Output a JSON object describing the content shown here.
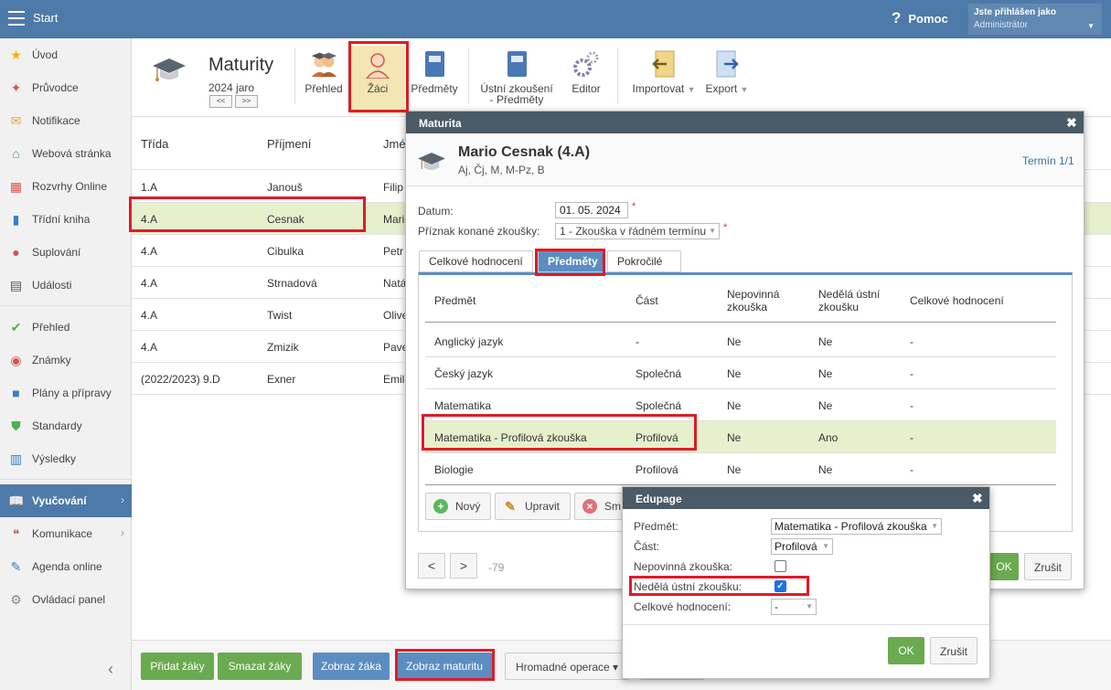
{
  "topbar": {
    "start": "Start",
    "help": "Pomoc",
    "user_line1": "Jste přihlášen jako",
    "user_line2": "Administrátor"
  },
  "sidebar": {
    "items": [
      {
        "label": "Úvod",
        "icon": "star-icon",
        "color": "#f2b200"
      },
      {
        "label": "Průvodce",
        "icon": "magic-wand-icon",
        "color": "#d9534f"
      },
      {
        "label": "Notifikace",
        "icon": "envelope-icon",
        "color": "#f0a030"
      },
      {
        "label": "Webová stránka",
        "icon": "home-icon",
        "color": "#3fa35c"
      },
      {
        "label": "Rozvrhy Online",
        "icon": "timetable-icon",
        "color": "#d9534f"
      },
      {
        "label": "Třídní kniha",
        "icon": "book-icon",
        "color": "#3a7ec4"
      },
      {
        "label": "Suplování",
        "icon": "person-icon",
        "color": "#d9534f"
      },
      {
        "label": "Události",
        "icon": "calendar-icon",
        "color": "#555555"
      },
      {
        "label": "Přehled",
        "icon": "check-circle-icon",
        "color": "#4caf50"
      },
      {
        "label": "Známky",
        "icon": "grade-icon",
        "color": "#d9534f"
      },
      {
        "label": "Plány a přípravy",
        "icon": "briefcase-icon",
        "color": "#3a7ec4"
      },
      {
        "label": "Standardy",
        "icon": "shield-check-icon",
        "color": "#4caf50"
      },
      {
        "label": "Výsledky",
        "icon": "bar-chart-icon",
        "color": "#3a7ec4"
      },
      {
        "label": "Vyučování",
        "icon": "open-book-icon",
        "color": "#ffffff"
      },
      {
        "label": "Komunikace",
        "icon": "chat-icon",
        "color": "#d9534f"
      },
      {
        "label": "Agenda online",
        "icon": "pencil-icon",
        "color": "#3a7ec4"
      },
      {
        "label": "Ovládací panel",
        "icon": "gear-icon",
        "color": "#888888"
      }
    ]
  },
  "toolbar": {
    "title": "Maturity",
    "term": "2024 jaro",
    "prev": "<<",
    "next": ">>",
    "btn_prehled": "Přehled",
    "btn_zaci": "Žáci",
    "btn_predmety": "Předměty",
    "btn_ustni_1": "Ústní zkoušení",
    "btn_ustni_2": "- Předměty",
    "btn_editor": "Editor",
    "btn_import": "Importovat",
    "btn_export": "Export"
  },
  "grid": {
    "headers": [
      "Třída",
      "Příjmení",
      "Jmé"
    ],
    "rows": [
      [
        "1.A",
        "Janouš",
        "Filip"
      ],
      [
        "4.A",
        "Cesnak",
        "Mari"
      ],
      [
        "4.A",
        "Cibulka",
        "Petr"
      ],
      [
        "4.A",
        "Strnadová",
        "Natá"
      ],
      [
        "4.A",
        "Twist",
        "Olive"
      ],
      [
        "4.A",
        "Zmizik",
        "Pave"
      ],
      [
        "(2022/2023) 9.D",
        "Exner",
        "Emil"
      ]
    ]
  },
  "bottombar": {
    "add": "Přidat žáky",
    "delete": "Smazat žáky",
    "show_student": "Zobraz žáka",
    "show_maturita": "Zobraz maturitu",
    "bulk": "Hromadné operace ▾"
  },
  "dialog": {
    "title": "Maturita",
    "student_name": "Mario Cesnak (4.A)",
    "subjects": "Aj, Čj, M, M-Pz, B",
    "term": "Termín 1/1",
    "date_label": "Datum:",
    "date_value": "01. 05. 2024",
    "flag_label": "Příznak konané zkoušky:",
    "flag_value": "1 - Zkouška v řádném termínu",
    "req": "*",
    "tabs": [
      "Celkové hodnocení",
      "Předměty",
      "Pokročilé"
    ],
    "table_headers": {
      "h1": "Předmět",
      "h2": "Část",
      "h3a": "Nepovinná",
      "h3b": "zkouška",
      "h4a": "Nedělá ústní",
      "h4b": "zkoušku",
      "h5": "Celkové hodnocení"
    },
    "rows": [
      [
        "Anglický jazyk",
        "-",
        "Ne",
        "Ne",
        "-"
      ],
      [
        "Český jazyk",
        "Společná",
        "Ne",
        "Ne",
        "-"
      ],
      [
        "Matematika",
        "Společná",
        "Ne",
        "Ne",
        "-"
      ],
      [
        "Matematika - Profilová zkouška",
        "Profilová",
        "Ne",
        "Ano",
        "-"
      ],
      [
        "Biologie",
        "Profilová",
        "Ne",
        "Ne",
        "-"
      ]
    ],
    "btn_new": "Nový",
    "btn_edit": "Upravit",
    "btn_delete": "Sm",
    "nav_prev": "<",
    "nav_next": ">",
    "counter": "-79",
    "ok": "OK",
    "cancel": "Zrušit"
  },
  "edupage": {
    "title": "Edupage",
    "subject_label": "Předmět:",
    "subject_value": "Matematika - Profilová zkouška",
    "part_label": "Část:",
    "part_value": "Profilová",
    "optional_label": "Nepovinná zkouška:",
    "optional_checked": false,
    "nooral_label": "Nedělá ústní zkoušku:",
    "nooral_checked": true,
    "total_label": "Celkové hodnocení:",
    "total_value": "-",
    "ok": "OK",
    "cancel": "Zrušit"
  }
}
